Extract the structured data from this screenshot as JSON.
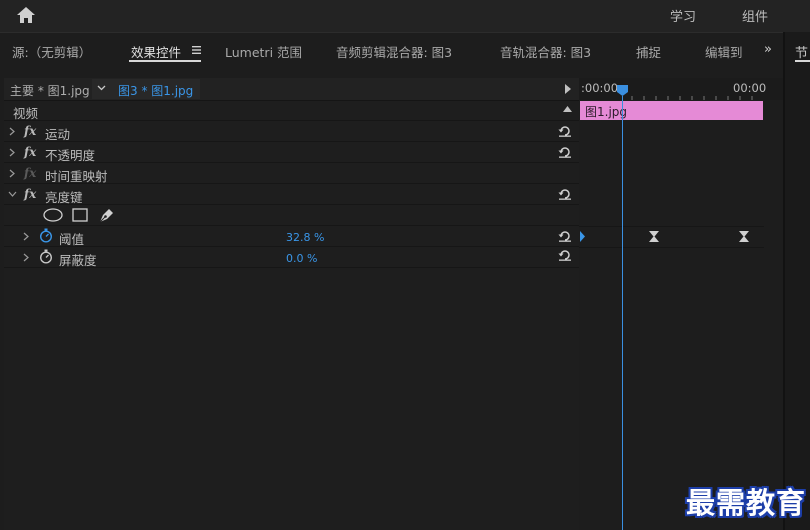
{
  "topbar": {
    "nav": [
      "学习",
      "组件"
    ]
  },
  "tabs": [
    {
      "label": "源:（无剪辑）"
    },
    {
      "label": "效果控件"
    },
    {
      "label": "Lumetri 范围"
    },
    {
      "label": "音频剪辑混合器: 图3"
    },
    {
      "label": "音轨混合器: 图3"
    },
    {
      "label": "捕捉"
    },
    {
      "label": "编辑到"
    }
  ],
  "tab_overflow": "»",
  "right_pane_tab": "节",
  "clipbar": {
    "master": "主要 * 图1.jpg",
    "sequence": "图3 * 图1.jpg"
  },
  "section": "视频",
  "effects": [
    {
      "label": "运动"
    },
    {
      "label": "不透明度"
    },
    {
      "label": "时间重映射"
    },
    {
      "label": "亮度键"
    }
  ],
  "params": [
    {
      "label": "阈值",
      "value": "32.8 %"
    },
    {
      "label": "屏蔽度",
      "value": "0.0 %"
    }
  ],
  "timeline": {
    "tc_start": ":00:00",
    "tc_end": "00:00",
    "clip_label": "图1.jpg"
  },
  "watermark": "最需教育",
  "colors": {
    "accent": "#3a96e8",
    "clip": "#e58ad6",
    "playhead": "#3a8fe0"
  }
}
